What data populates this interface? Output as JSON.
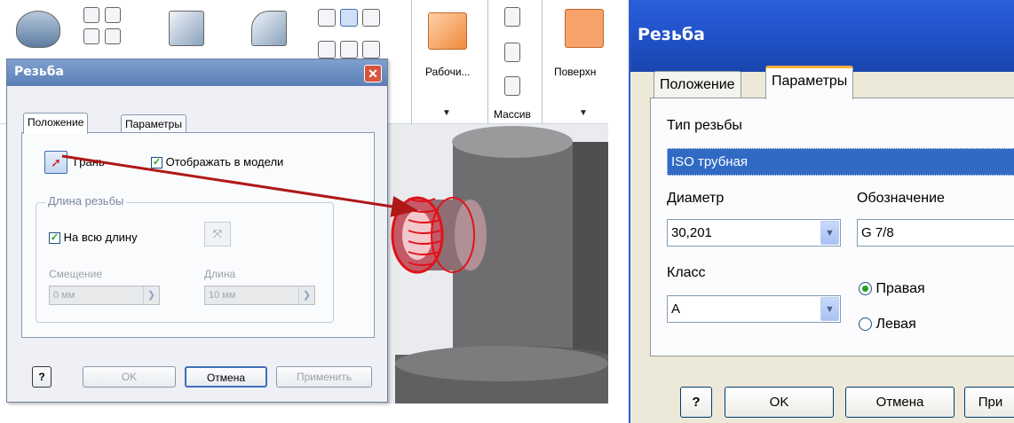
{
  "ribbon": {
    "work_label": "Рабочи...",
    "surface_label": "Поверхн",
    "array_label": "Массив"
  },
  "dialog_left": {
    "title": "Резьба",
    "tabs": [
      "Положение",
      "Параметры"
    ],
    "face_label": "Грань",
    "show_in_model_label": "Отображать в модели",
    "thread_length_group": "Длина резьбы",
    "full_length_label": "На всю длину",
    "offset_label": "Смещение",
    "length_label": "Длина",
    "offset_value": "0 мм",
    "length_value": "10 мм",
    "buttons": {
      "ok": "OK",
      "cancel": "Отмена",
      "apply": "Применить",
      "help": "?"
    }
  },
  "dialog_right": {
    "title": "Резьба",
    "tabs": [
      "Положение",
      "Параметры"
    ],
    "thread_type_label": "Тип резьбы",
    "thread_type_value": "ISO трубная",
    "diameter_label": "Диаметр",
    "diameter_value": "30,201",
    "designation_label": "Обозначение",
    "designation_value": "G 7/8",
    "class_label": "Класс",
    "class_value": "A",
    "right_label": "Правая",
    "left_label": "Левая",
    "buttons": {
      "ok": "OK",
      "cancel": "Отмена",
      "apply": "При",
      "help": "?"
    }
  },
  "colors": {
    "arrow": "#b01818",
    "thread_highlight": "#e0121a",
    "xp_title": "#2a5fdc",
    "checkbox_green": "#21a121"
  }
}
